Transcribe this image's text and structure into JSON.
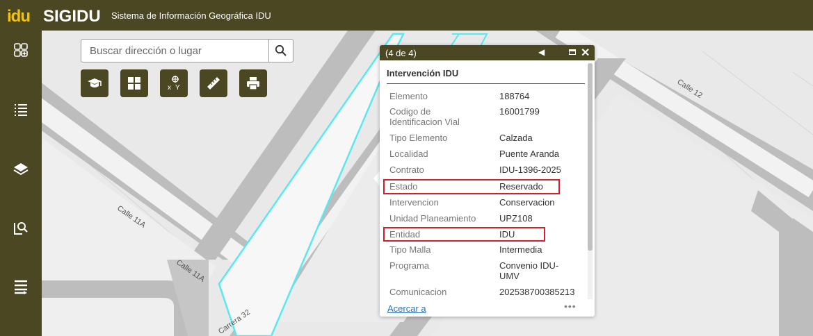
{
  "header": {
    "logo": "idu",
    "app_name": "SIGIDU",
    "app_subtitle": "Sistema de Información Geográfica IDU"
  },
  "sidebar": {
    "items": [
      {
        "icon": "widgets-grid-icon"
      },
      {
        "icon": "list-icon"
      },
      {
        "icon": "layers-icon"
      },
      {
        "icon": "search-zoom-icon"
      },
      {
        "icon": "menu-lines-icon"
      }
    ]
  },
  "search": {
    "placeholder": "Buscar dirección o lugar",
    "button_icon": "search-icon"
  },
  "toolbar": {
    "buttons": [
      {
        "icon": "graduation-cap-icon"
      },
      {
        "icon": "basemap-grid-icon"
      },
      {
        "icon": "coordinates-xy-icon"
      },
      {
        "icon": "ruler-icon"
      },
      {
        "icon": "printer-icon"
      }
    ]
  },
  "map": {
    "street_labels": [
      "Calle 11A",
      "Calle 11A",
      "Calle 12",
      "Carrera 32"
    ],
    "colors": {
      "road": "#bdbdbd",
      "background": "#e9e9e9",
      "parcel_outline": "#5ae8ef",
      "block": "#f3f3f3"
    }
  },
  "popup": {
    "counter": "(4 de 4)",
    "title": "Intervención IDU",
    "fields": [
      {
        "label": "Elemento",
        "value": "188764"
      },
      {
        "label": "Codigo de Identificacion Vial",
        "value": "16001799"
      },
      {
        "label": "Tipo Elemento",
        "value": "Calzada"
      },
      {
        "label": "Localidad",
        "value": "Puente Aranda"
      },
      {
        "label": "Contrato",
        "value": "IDU-1396-2025"
      },
      {
        "label": "Estado",
        "value": "Reservado"
      },
      {
        "label": "Intervencion",
        "value": "Conservacion"
      },
      {
        "label": "Unidad Planeamiento",
        "value": "UPZ108"
      },
      {
        "label": "Entidad",
        "value": "IDU"
      },
      {
        "label": "Tipo Malla",
        "value": "Intermedia"
      },
      {
        "label": "Programa",
        "value": "Convenio IDU-UMV"
      },
      {
        "label": "Comunicacion",
        "value": "202538700385213"
      }
    ],
    "zoom_link": "Acercar a",
    "more_label": "•••",
    "highlight_color": "#d0202e",
    "header_color": "#4a4722"
  }
}
